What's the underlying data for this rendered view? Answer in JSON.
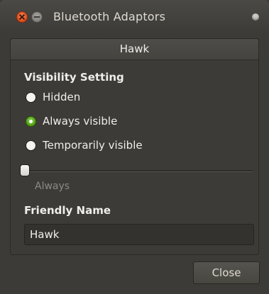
{
  "window": {
    "title": "Bluetooth Adaptors",
    "controls": [
      "close-icon",
      "minimize-icon",
      "menu-icon"
    ]
  },
  "tabs": [
    {
      "label": "Hawk",
      "selected": true
    }
  ],
  "visibility": {
    "heading": "Visibility Setting",
    "options": [
      {
        "label": "Hidden",
        "checked": false
      },
      {
        "label": "Always visible",
        "checked": true
      },
      {
        "label": "Temporarily visible",
        "checked": false
      }
    ],
    "timeout_value_label": "Always",
    "slider_fraction": 0.0
  },
  "friendly_name": {
    "heading": "Friendly Name",
    "value": "Hawk"
  },
  "footer": {
    "close_label": "Close"
  },
  "colors": {
    "accent_radio": "#4e9a06",
    "window_bg": "#3c3b37",
    "close_button": "#df4a16"
  }
}
